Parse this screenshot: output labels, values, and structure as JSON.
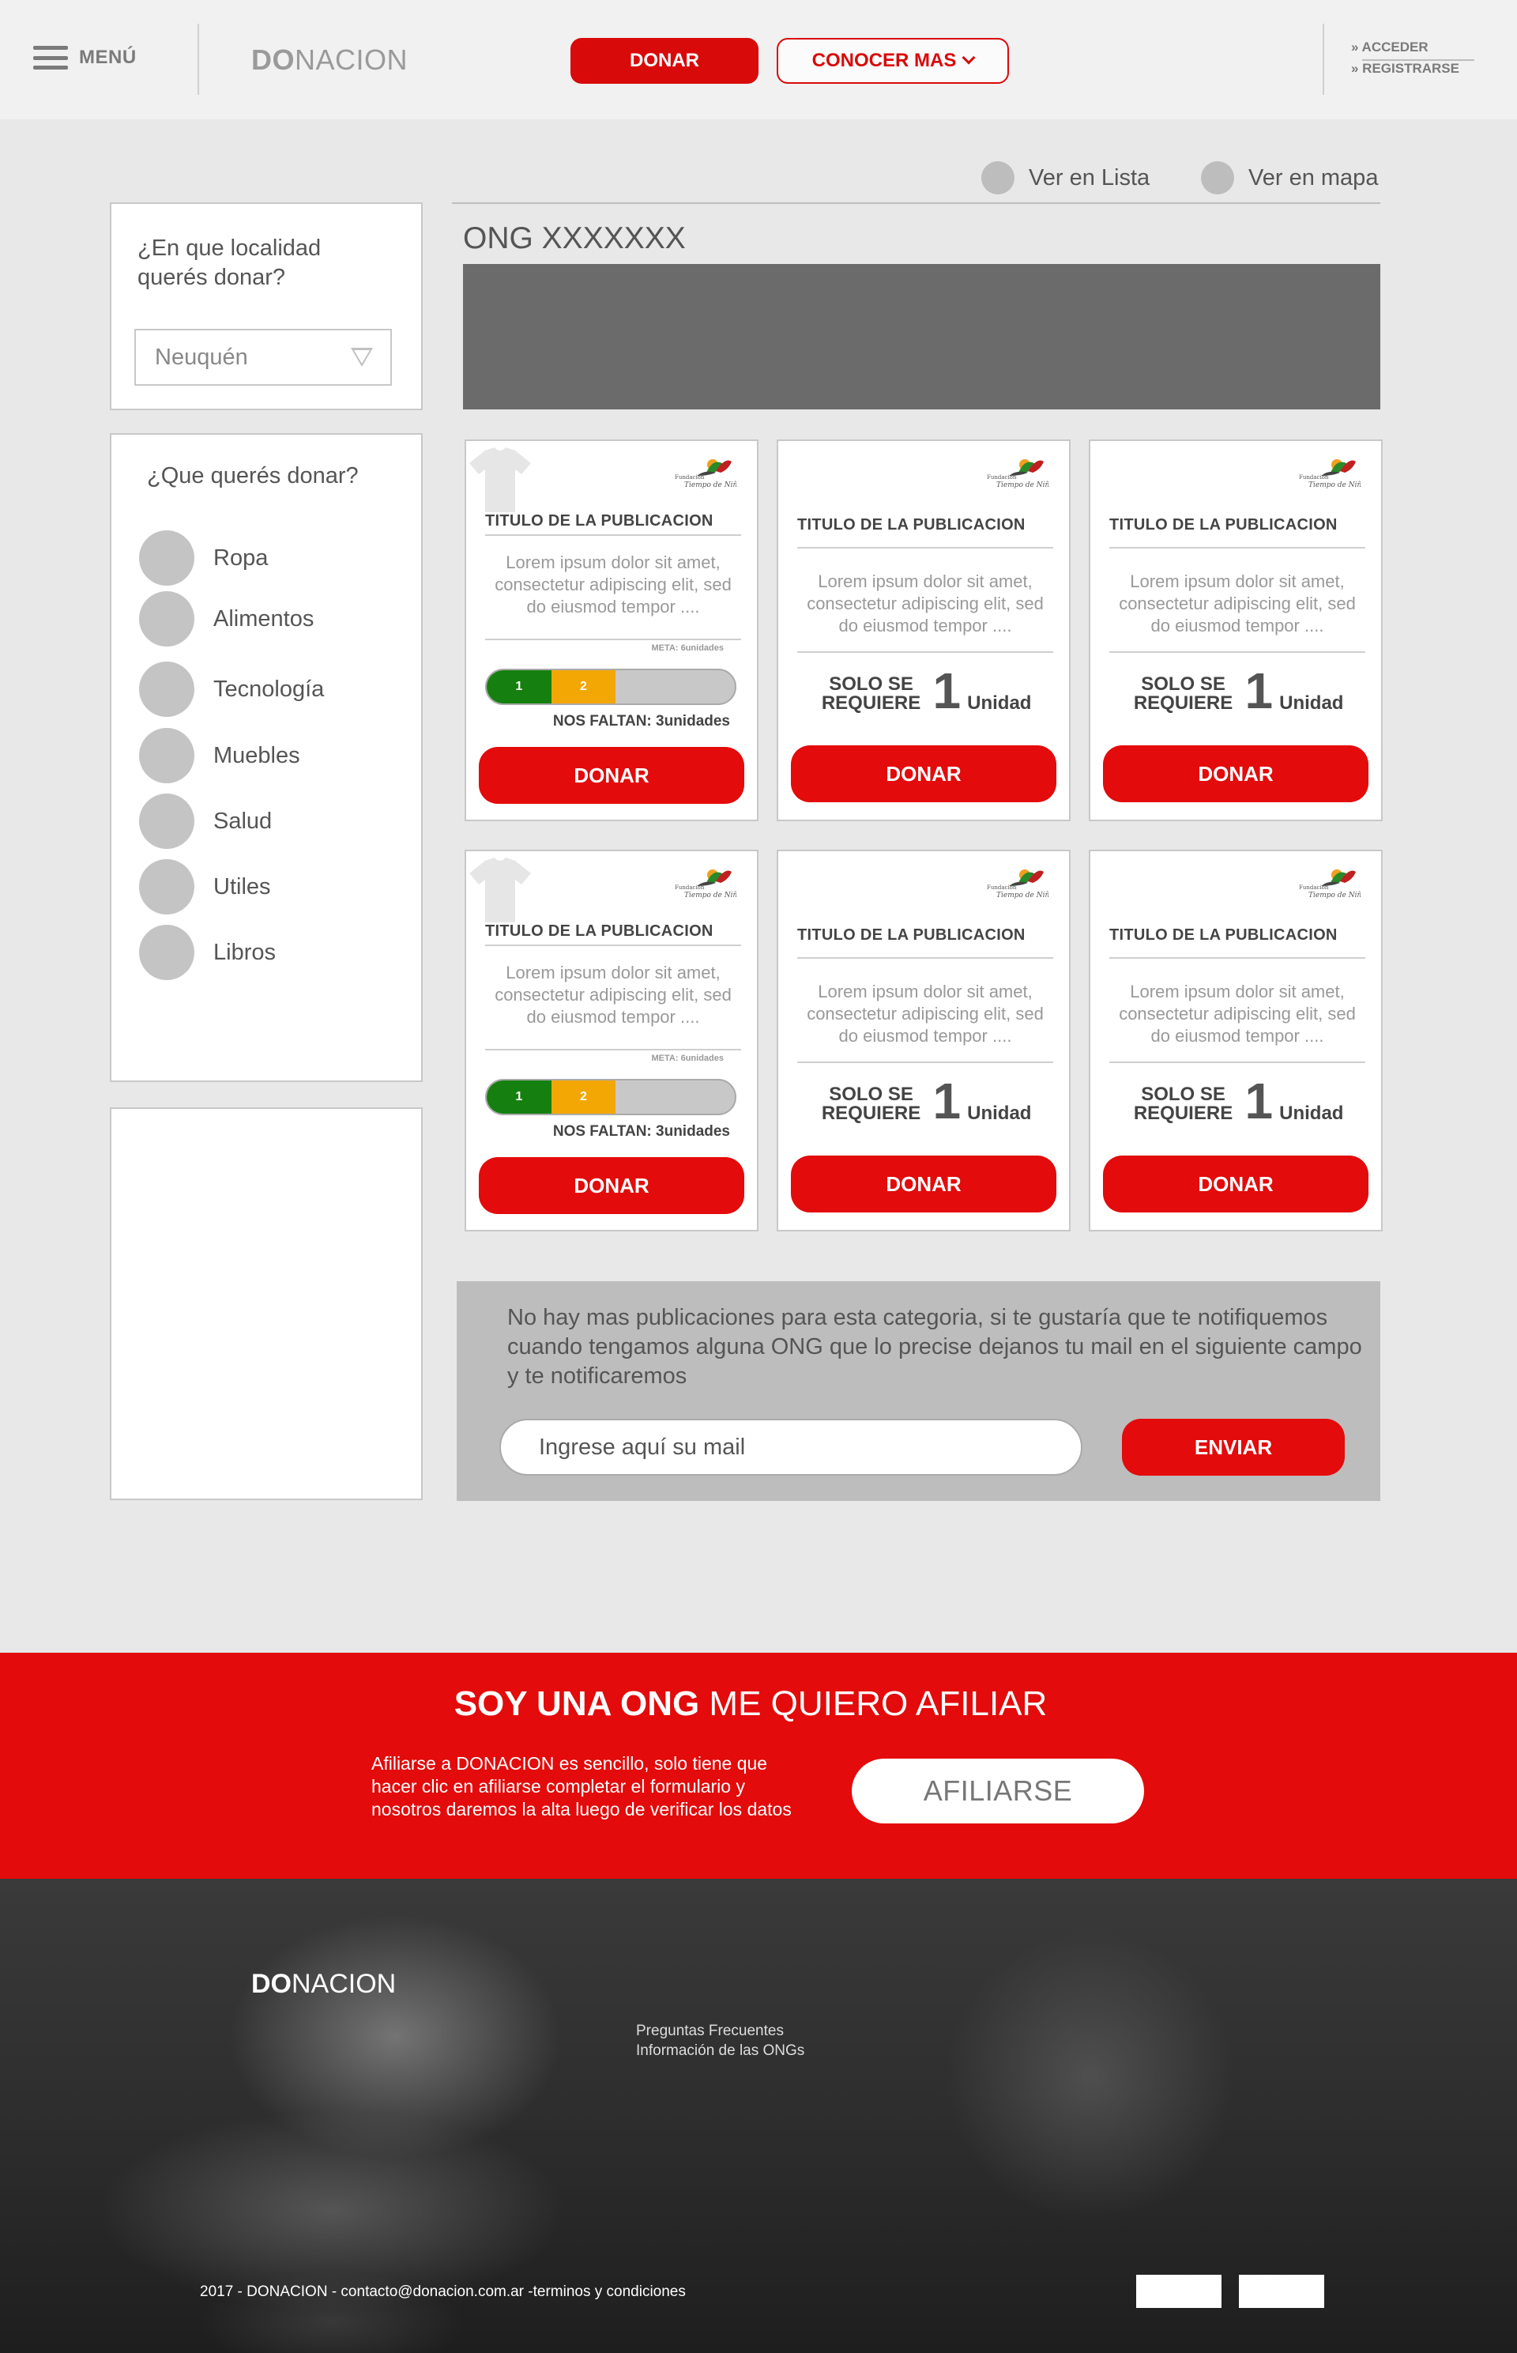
{
  "header": {
    "menu_label": "MENÚ",
    "logo_bold": "DO",
    "logo_rest": "NACION",
    "donate_button": "DONAR",
    "learn_more_button": "CONOCER MAS",
    "login_link": "» ACCEDER",
    "register_link": "» REGISTRARSE"
  },
  "view": {
    "list_label": "Ver en Lista",
    "map_label": "Ver en mapa"
  },
  "sidebar": {
    "location_question": "¿En que localidad querés donar?",
    "location_selected": "Neuquén",
    "donate_question": "¿Que querés donar?",
    "categories": [
      "Ropa",
      "Alimentos",
      "Tecnología",
      "Muebles",
      "Salud",
      "Utiles",
      "Libros"
    ]
  },
  "main": {
    "ong_title": "ONG XXXXXXX",
    "cards": [
      {
        "title": "TITULO DE LA PUBLICACION",
        "description": "Lorem ipsum dolor sit amet, consectetur adipiscing elit, sed do eiusmod tempor ....",
        "type": "progress",
        "meta": "META: 6unidades",
        "seg1": "1",
        "seg2": "2",
        "progress_green": 0.26,
        "progress_orange": 0.26,
        "missing": "NOS FALTAN: 3unidades",
        "button": "DONAR",
        "icon": "tshirt-icon"
      },
      {
        "title": "TITULO DE LA PUBLICACION",
        "description": "Lorem ipsum dolor sit amet, consectetur adipiscing elit, sed do eiusmod tempor ....",
        "type": "required",
        "req_small": "SOLO SE REQUIERE",
        "req_number": "1",
        "req_unit": "Unidad",
        "button": "DONAR"
      },
      {
        "title": "TITULO DE LA PUBLICACION",
        "description": "Lorem ipsum dolor sit amet, consectetur adipiscing elit, sed do eiusmod tempor ....",
        "type": "required",
        "req_small": "SOLO SE REQUIERE",
        "req_number": "1",
        "req_unit": "Unidad",
        "button": "DONAR"
      },
      {
        "title": "TITULO DE LA PUBLICACION",
        "description": "Lorem ipsum dolor sit amet, consectetur adipiscing elit, sed do eiusmod tempor ....",
        "type": "progress",
        "meta": "META: 6unidades",
        "seg1": "1",
        "seg2": "2",
        "progress_green": 0.26,
        "progress_orange": 0.26,
        "missing": "NOS FALTAN: 3unidades",
        "button": "DONAR",
        "icon": "tshirt-icon"
      },
      {
        "title": "TITULO DE LA PUBLICACION",
        "description": "Lorem ipsum dolor sit amet, consectetur adipiscing elit, sed do eiusmod tempor ....",
        "type": "required",
        "req_small": "SOLO SE REQUIERE",
        "req_number": "1",
        "req_unit": "Unidad",
        "button": "DONAR"
      },
      {
        "title": "TITULO DE LA PUBLICACION",
        "description": "Lorem ipsum dolor sit amet, consectetur adipiscing elit, sed do eiusmod tempor ....",
        "type": "required",
        "req_small": "SOLO SE REQUIERE",
        "req_number": "1",
        "req_unit": "Unidad",
        "button": "DONAR"
      }
    ],
    "org_logo_text": "Fundación Tiempo de Niños"
  },
  "notify": {
    "text": "No hay mas publicaciones para esta categoria, si te gustaría que te notifiquemos cuando tengamos alguna ONG que lo precise dejanos tu mail en el siguiente campo y te notificaremos",
    "input_placeholder": "Ingrese aquí su mail",
    "button": "ENVIAR"
  },
  "afiliar": {
    "title_bold": "SOY UNA ONG",
    "title_rest": " ME QUIERO AFILIAR",
    "text": "Afiliarse a DONACION es sencillo, solo tiene que hacer clic en afiliarse completar el formulario y nosotros daremos la alta luego de verificar los datos",
    "button": "AFILIARSE"
  },
  "footer": {
    "logo_bold": "DO",
    "logo_rest": "NACION",
    "links": [
      "Preguntas Frecuentes",
      "Información de las ONGs"
    ],
    "copyright": "2017 - DONACION - contacto@donacion.com.ar -terminos y condiciones"
  },
  "colors": {
    "accent": "#e30b0b",
    "progress_green": "#15800f",
    "progress_orange": "#f2a705",
    "banner": "#6b6b6b"
  }
}
